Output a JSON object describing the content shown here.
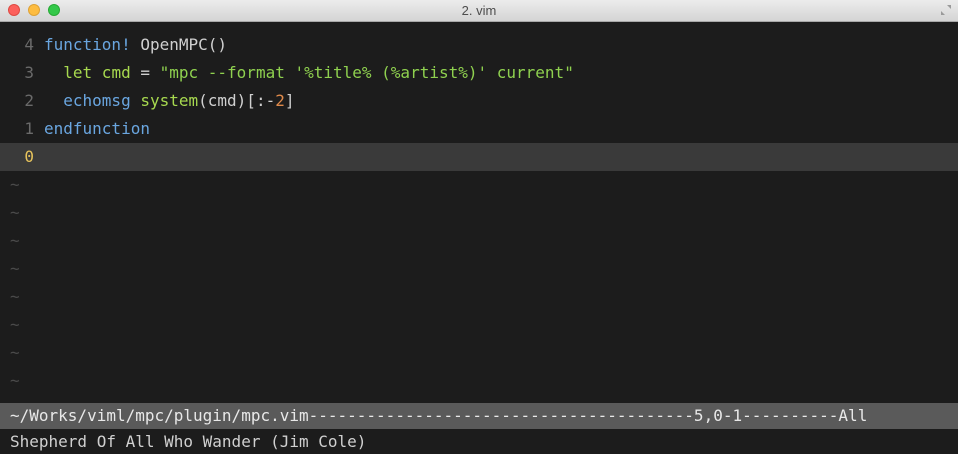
{
  "window": {
    "title": "2. vim",
    "colors": {
      "close": "#fc605c",
      "minimize": "#fdbc40",
      "maximize": "#34c84a"
    }
  },
  "editor": {
    "lines": [
      {
        "number": "4",
        "tokens": [
          {
            "text": "function!",
            "kind": "kw"
          },
          {
            "text": " OpenMPC()",
            "kind": "ident"
          }
        ]
      },
      {
        "number": "3",
        "tokens": [
          {
            "text": "  let",
            "kind": "fn"
          },
          {
            "text": " cmd",
            "kind": "fn"
          },
          {
            "text": " = ",
            "kind": "ident"
          },
          {
            "text": "\"mpc --format '%title% (%artist%)' current\"",
            "kind": "str"
          }
        ]
      },
      {
        "number": "2",
        "tokens": [
          {
            "text": "  echomsg",
            "kind": "kw"
          },
          {
            "text": " system",
            "kind": "fn"
          },
          {
            "text": "(cmd)[:-",
            "kind": "ident"
          },
          {
            "text": "2",
            "kind": "num"
          },
          {
            "text": "]",
            "kind": "ident"
          }
        ]
      },
      {
        "number": "1",
        "tokens": [
          {
            "text": "endfunction",
            "kind": "kw"
          }
        ]
      },
      {
        "number": "0",
        "tokens": [],
        "current": true
      }
    ],
    "tilde": "~",
    "tilde_count": 8
  },
  "statusline": {
    "text": "~/Works/viml/mpc/plugin/mpc.vim----------------------------------------5,0-1----------All"
  },
  "cmdline": {
    "text": "Shepherd Of All Who Wander (Jim Cole)"
  },
  "icons": {
    "fullscreen": "fullscreen-arrows-icon"
  }
}
